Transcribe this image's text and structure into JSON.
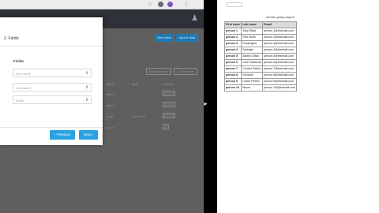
{
  "modal": {
    "title": "2. Fields",
    "fields_header": "Fields",
    "selects": [
      "First name",
      "Last name",
      "Email"
    ],
    "prev_label": "‹ Previous",
    "next_label": "Next ›"
  },
  "bg": {
    "top_buttons": [
      "New table",
      "Import data"
    ],
    "filter_buttons": [
      "Bulk actions ▾",
      "Columns ▾"
    ],
    "table_headers": [
      "Name",
      "Type",
      "Actions"
    ],
    "rows": [
      {
        "name": "Name",
        "type": ""
      },
      {
        "name": "Name",
        "type": ""
      },
      {
        "name": "Email",
        "type": "Text/Email"
      },
      {
        "name": "Name",
        "type": ""
      }
    ]
  },
  "report": {
    "title": "sender group export",
    "headers": [
      "First name",
      "Last name",
      "Email"
    ],
    "rows": [
      [
        "person 1",
        "Tony Stark",
        "person.1@testmail.com"
      ],
      [
        "person 2",
        "Red Smith",
        "person.2@testmail.com"
      ],
      [
        "person 3",
        "Ruskington",
        "person.3@testmail.com"
      ],
      [
        "person 4",
        "Springer",
        "person.4@testmail.com"
      ],
      [
        "person 5",
        "Ashley Davis",
        "person.5@testmail.com"
      ],
      [
        "person 6",
        "Luke Dackman",
        "person.6@testmail.com"
      ],
      [
        "person 7",
        "Conner Peters",
        "person.7@testmail.com"
      ],
      [
        "person 8",
        "Sommer",
        "person.8@testmail.com"
      ],
      [
        "person 9",
        "Lester Peters",
        "person.9@testmail.com"
      ],
      [
        "person 10",
        "Moore",
        "person.10@testmail.com"
      ]
    ]
  },
  "colors": {
    "primary": "#29a3e0",
    "nav": "#2e3238",
    "overlay": "#5f5f5f"
  }
}
